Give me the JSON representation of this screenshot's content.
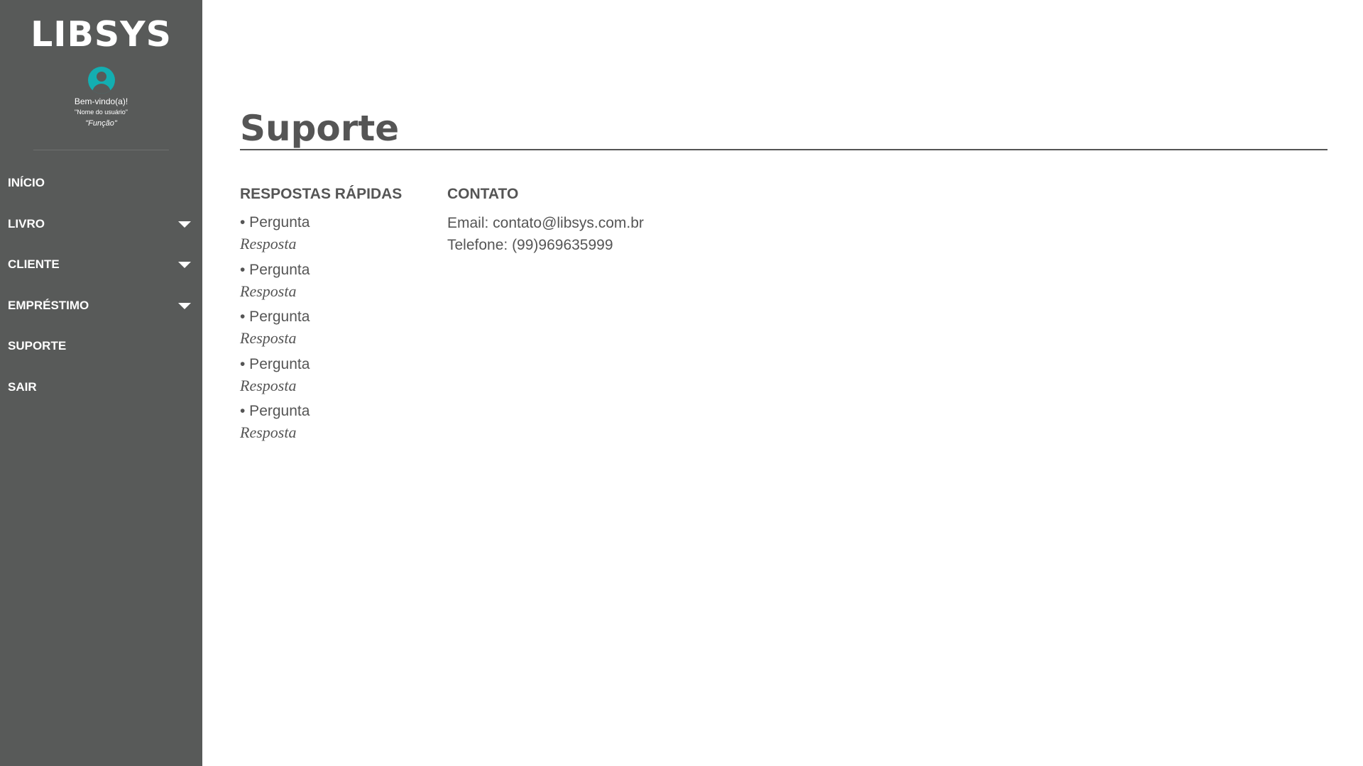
{
  "sidebar": {
    "logo": "LIBSYS",
    "avatar_icon": "user-avatar-icon",
    "welcome": "Bem-vindo(a)!",
    "username": "\"Nome do usuário\"",
    "role": "\"Função\"",
    "nav": [
      {
        "label": "INÍCIO",
        "has_dropdown": false
      },
      {
        "label": "LIVRO",
        "has_dropdown": true
      },
      {
        "label": "CLIENTE",
        "has_dropdown": true
      },
      {
        "label": "EMPRÉSTIMO",
        "has_dropdown": true
      },
      {
        "label": "SUPORTE",
        "has_dropdown": false
      },
      {
        "label": "SAIR",
        "has_dropdown": false
      }
    ]
  },
  "main": {
    "title": "Suporte",
    "faq": {
      "heading": "RESPOSTAS RÁPIDAS",
      "items": [
        {
          "question": "• Pergunta",
          "answer": "Resposta"
        },
        {
          "question": "• Pergunta",
          "answer": "Resposta"
        },
        {
          "question": "• Pergunta",
          "answer": "Resposta"
        },
        {
          "question": "• Pergunta",
          "answer": "Resposta"
        },
        {
          "question": "• Pergunta",
          "answer": "Resposta"
        }
      ]
    },
    "contact": {
      "heading": "CONTATO",
      "email": "Email: contato@libsys.com.br",
      "phone": "Telefone: (99)969635999"
    }
  },
  "colors": {
    "sidebar_bg": "#585a59",
    "accent": "#13aeb1",
    "text": "#555555"
  }
}
